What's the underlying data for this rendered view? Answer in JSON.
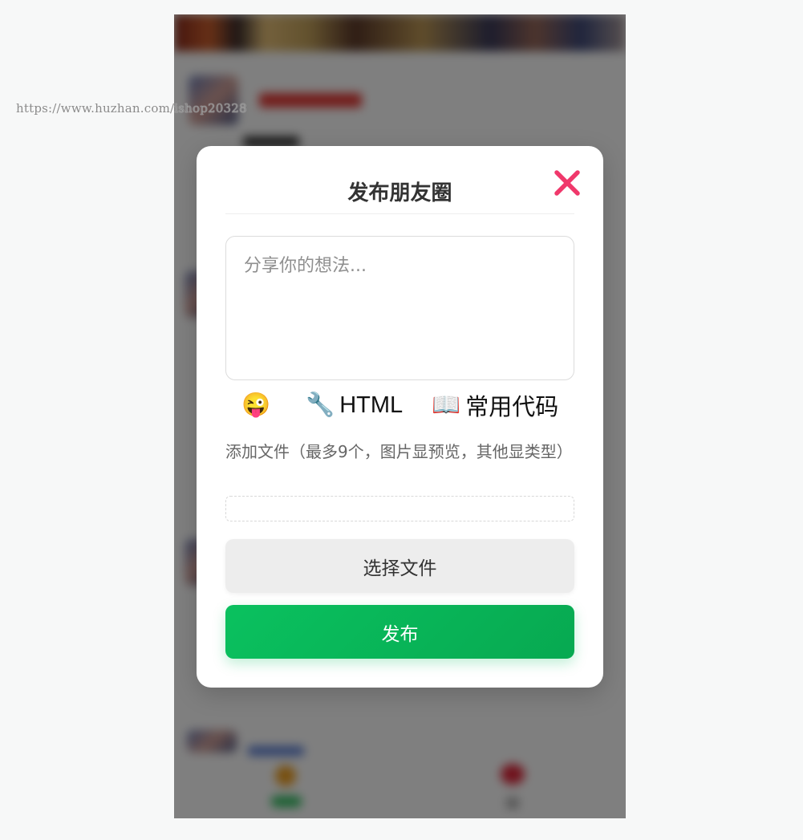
{
  "watermark": "https://www.huzhan.com/ishop20328",
  "modal": {
    "title": "发布朋友圈",
    "textarea_placeholder": "分享你的想法...",
    "toolbar": {
      "emoji": "😜",
      "html_icon": "🔧",
      "html_label": "HTML",
      "code_icon": "📖",
      "code_label": "常用代码"
    },
    "file_hint": "添加文件（最多9个，图片显预览，其他显类型）",
    "choose_file_label": "选择文件",
    "publish_label": "发布"
  },
  "colors": {
    "close": "#f0386b",
    "publish_start": "#0ac15f",
    "publish_end": "#07a951"
  },
  "icons": {
    "close": "close-icon",
    "emoji": "emoji-icon",
    "html": "wrench-icon",
    "code": "book-icon"
  }
}
